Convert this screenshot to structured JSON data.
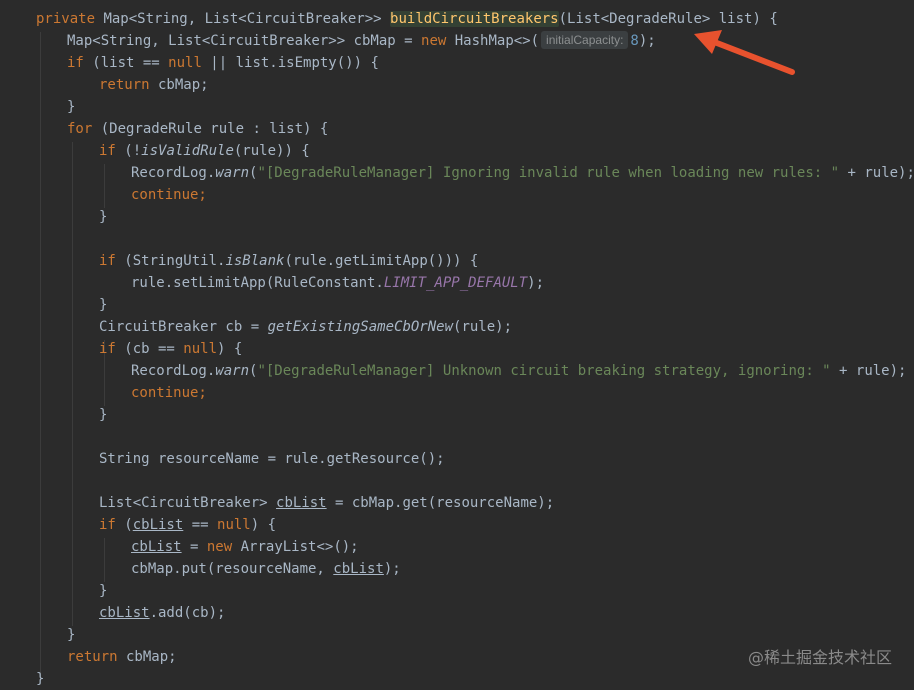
{
  "editor": {
    "theme_background": "#2b2b2b",
    "colors": {
      "keyword": "#cc7832",
      "function": "#ffc66d",
      "string": "#6a8759",
      "constant": "#9876aa",
      "number": "#6897bb",
      "default": "#a9b7c6",
      "arrow": "#e8522e"
    },
    "code": {
      "l1": {
        "kw": "private",
        "t1": " Map<String, List<CircuitBreaker>> ",
        "fn": "buildCircuitBreakers",
        "t2": "(List<DegradeRule> list) {"
      },
      "l2": {
        "t1": "Map<String, List<CircuitBreaker>> cbMap = ",
        "kw": "new",
        "t2": " HashMap<>(",
        "hint": "initialCapacity:",
        "num": "8",
        "t3": ");"
      },
      "l3": {
        "kw": "if",
        "t1": " (list == ",
        "kw2": "null",
        "t2": " || list.isEmpty()) {"
      },
      "l4": {
        "kw": "return",
        "t1": " cbMap;"
      },
      "l5": {
        "t1": "}"
      },
      "l6": {
        "kw": "for",
        "t1": " (DegradeRule rule : list) {"
      },
      "l7": {
        "kw": "if",
        "t1": " (!",
        "it": "isValidRule",
        "t2": "(rule)) {"
      },
      "l8": {
        "t1": "RecordLog.",
        "it": "warn",
        "t2": "(",
        "str": "\"[DegradeRuleManager] Ignoring invalid rule when loading new rules: \"",
        "t3": " + rule);"
      },
      "l9": {
        "kw": "continue;"
      },
      "l10": {
        "t1": "}"
      },
      "l11": {
        "kw": "if",
        "t1": " (StringUtil.",
        "it": "isBlank",
        "t2": "(rule.getLimitApp())) {"
      },
      "l12": {
        "t1": "rule.setLimitApp(RuleConstant.",
        "const": "LIMIT_APP_DEFAULT",
        "t2": ");"
      },
      "l13": {
        "t1": "}"
      },
      "l14": {
        "t1": "CircuitBreaker cb = ",
        "it": "getExistingSameCbOrNew",
        "t2": "(rule);"
      },
      "l15": {
        "kw": "if",
        "t1": " (cb == ",
        "kw2": "null",
        "t2": ") {"
      },
      "l16": {
        "t1": "RecordLog.",
        "it": "warn",
        "t2": "(",
        "str": "\"[DegradeRuleManager] Unknown circuit breaking strategy, ignoring: \"",
        "t3": " + rule);"
      },
      "l17": {
        "kw": "continue;"
      },
      "l18": {
        "t1": "}"
      },
      "l19": {
        "t1": "String resourceName = rule.getResource();"
      },
      "l20": {
        "t1": "List<CircuitBreaker> ",
        "u": "cbList",
        "t2": " = cbMap.get(resourceName);"
      },
      "l21": {
        "kw": "if",
        "t1": " (",
        "u": "cbList",
        "t2": " == ",
        "kw2": "null",
        "t3": ") {"
      },
      "l22": {
        "u": "cbList",
        "t1": " = ",
        "kw": "new",
        "t2": " ArrayList<>();"
      },
      "l23": {
        "t1": "cbMap.put(resourceName, ",
        "u": "cbList",
        "t2": ");"
      },
      "l24": {
        "t1": "}"
      },
      "l25": {
        "u": "cbList",
        "t1": ".add(cb);"
      },
      "l26": {
        "t1": "}"
      },
      "l27": {
        "kw": "return",
        "t1": " cbMap;"
      },
      "l28": {
        "t1": "}"
      }
    }
  },
  "watermark": "@稀土掘金技术社区",
  "annotation": {
    "icon": "red-arrow-icon"
  }
}
